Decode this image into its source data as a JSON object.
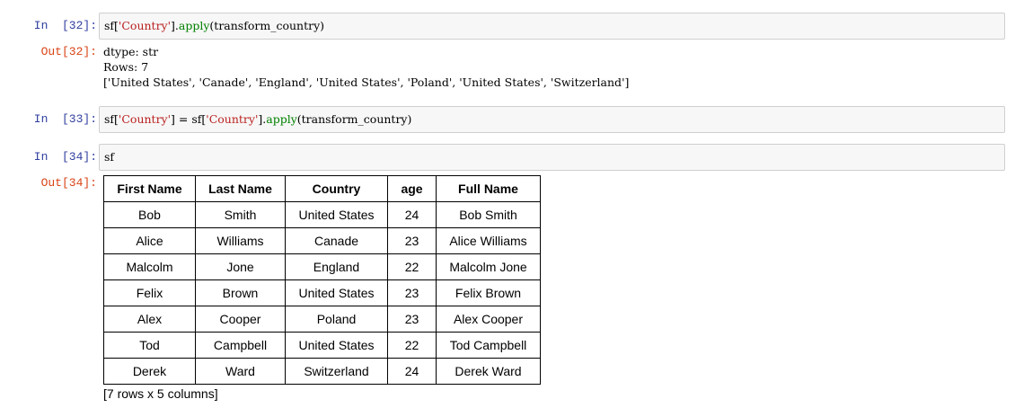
{
  "cells": [
    {
      "in_prompt": "In  [32]:",
      "code": {
        "pre": "sf[",
        "str1": "'Country'",
        "mid": "].",
        "fn": "apply",
        "post": "(transform_country)"
      },
      "out_prompt": "Out[32]:",
      "output_lines": [
        "dtype: str",
        "Rows: 7",
        "['United States', 'Canade', 'England', 'United States', 'Poland', 'United States', 'Switzerland']"
      ]
    },
    {
      "in_prompt": "In  [33]:",
      "code": {
        "pre": "sf[",
        "str1": "'Country'",
        "mid1": "] = sf[",
        "str2": "'Country'",
        "mid2": "].",
        "fn": "apply",
        "post": "(transform_country)"
      }
    },
    {
      "in_prompt": "In  [34]:",
      "code": {
        "text": "sf"
      },
      "out_prompt": "Out[34]:",
      "table": {
        "columns": [
          "First Name",
          "Last Name",
          "Country",
          "age",
          "Full Name"
        ],
        "rows": [
          [
            "Bob",
            "Smith",
            "United States",
            "24",
            "Bob Smith"
          ],
          [
            "Alice",
            "Williams",
            "Canade",
            "23",
            "Alice Williams"
          ],
          [
            "Malcolm",
            "Jone",
            "England",
            "22",
            "Malcolm Jone"
          ],
          [
            "Felix",
            "Brown",
            "United States",
            "23",
            "Felix Brown"
          ],
          [
            "Alex",
            "Cooper",
            "Poland",
            "23",
            "Alex Cooper"
          ],
          [
            "Tod",
            "Campbell",
            "United States",
            "22",
            "Tod Campbell"
          ],
          [
            "Derek",
            "Ward",
            "Switzerland",
            "24",
            "Derek Ward"
          ]
        ],
        "summary": "[7 rows x 5 columns]"
      }
    }
  ],
  "colors": {
    "in_prompt": "#303f9f",
    "out_prompt": "#d84315",
    "string": "#ba2121",
    "builtin": "#008000",
    "cell_bg": "#f7f7f7",
    "cell_border": "#cfcfcf"
  }
}
